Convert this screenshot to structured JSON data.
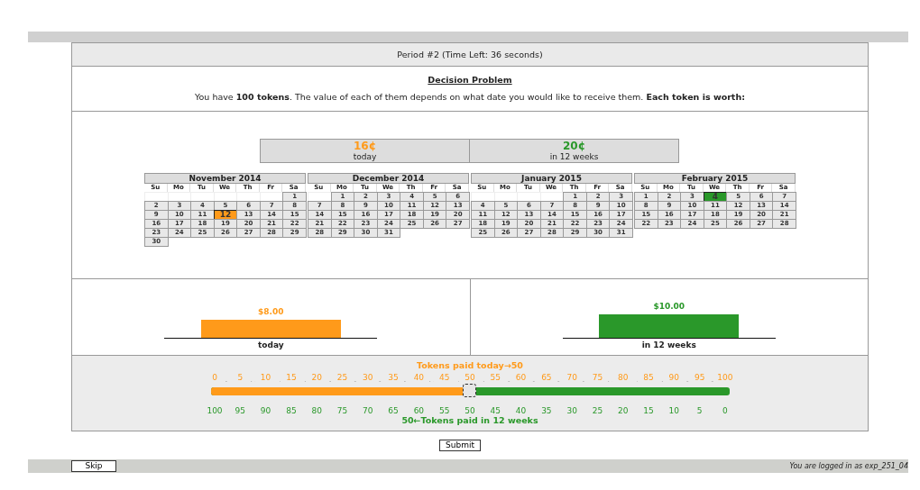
{
  "header": {
    "title": "Period #2 (Time Left: 36 seconds)"
  },
  "decision": {
    "heading": "Decision Problem",
    "text": "You have **100 tokens**. The value of each of them depends on what date you would like to receive them. **Each token is worth:**"
  },
  "values": [
    {
      "amount": "16¢",
      "when": "today",
      "color": "#ff9a1a"
    },
    {
      "amount": "20¢",
      "when": "in 12 weeks",
      "color": "#2a982a"
    }
  ],
  "calendars": [
    {
      "month": "November 2014",
      "weekdays": [
        "Su",
        "Mo",
        "Tu",
        "We",
        "Th",
        "Fr",
        "Sa"
      ],
      "weeks": [
        [
          {
            "kind": "blank"
          },
          {
            "kind": "blank"
          },
          {
            "kind": "blank"
          },
          {
            "kind": "blank"
          },
          {
            "kind": "blank"
          },
          {
            "kind": "blank"
          },
          {
            "kind": "day",
            "day": "1",
            "selected": false
          }
        ],
        [
          {
            "kind": "day",
            "day": "2",
            "selected": false
          },
          {
            "kind": "day",
            "day": "3",
            "selected": false
          },
          {
            "kind": "day",
            "day": "4",
            "selected": false
          },
          {
            "kind": "day",
            "day": "5",
            "selected": false
          },
          {
            "kind": "day",
            "day": "6",
            "selected": false
          },
          {
            "kind": "day",
            "day": "7",
            "selected": false
          },
          {
            "kind": "day",
            "day": "8",
            "selected": false
          }
        ],
        [
          {
            "kind": "day",
            "day": "9",
            "selected": false
          },
          {
            "kind": "day",
            "day": "10",
            "selected": false
          },
          {
            "kind": "day",
            "day": "11",
            "selected": false
          },
          {
            "kind": "day",
            "day": "12",
            "selected": true,
            "color": "#ff9a1a"
          },
          {
            "kind": "day",
            "day": "13",
            "selected": false
          },
          {
            "kind": "day",
            "day": "14",
            "selected": false
          },
          {
            "kind": "day",
            "day": "15",
            "selected": false
          }
        ],
        [
          {
            "kind": "day",
            "day": "16",
            "selected": false
          },
          {
            "kind": "day",
            "day": "17",
            "selected": false
          },
          {
            "kind": "day",
            "day": "18",
            "selected": false
          },
          {
            "kind": "day",
            "day": "19",
            "selected": false
          },
          {
            "kind": "day",
            "day": "20",
            "selected": false
          },
          {
            "kind": "day",
            "day": "21",
            "selected": false
          },
          {
            "kind": "day",
            "day": "22",
            "selected": false
          }
        ],
        [
          {
            "kind": "day",
            "day": "23",
            "selected": false
          },
          {
            "kind": "day",
            "day": "24",
            "selected": false
          },
          {
            "kind": "day",
            "day": "25",
            "selected": false
          },
          {
            "kind": "day",
            "day": "26",
            "selected": false
          },
          {
            "kind": "day",
            "day": "27",
            "selected": false
          },
          {
            "kind": "day",
            "day": "28",
            "selected": false
          },
          {
            "kind": "day",
            "day": "29",
            "selected": false
          }
        ],
        [
          {
            "kind": "day",
            "day": "30",
            "selected": false
          }
        ]
      ]
    },
    {
      "month": "December 2014",
      "weekdays": [
        "Su",
        "Mo",
        "Tu",
        "We",
        "Th",
        "Fr",
        "Sa"
      ],
      "weeks": [
        [
          {
            "kind": "blank"
          },
          {
            "kind": "day",
            "day": "1",
            "selected": false
          },
          {
            "kind": "day",
            "day": "2",
            "selected": false
          },
          {
            "kind": "day",
            "day": "3",
            "selected": false
          },
          {
            "kind": "day",
            "day": "4",
            "selected": false
          },
          {
            "kind": "day",
            "day": "5",
            "selected": false
          },
          {
            "kind": "day",
            "day": "6",
            "selected": false
          }
        ],
        [
          {
            "kind": "day",
            "day": "7",
            "selected": false
          },
          {
            "kind": "day",
            "day": "8",
            "selected": false
          },
          {
            "kind": "day",
            "day": "9",
            "selected": false
          },
          {
            "kind": "day",
            "day": "10",
            "selected": false
          },
          {
            "kind": "day",
            "day": "11",
            "selected": false
          },
          {
            "kind": "day",
            "day": "12",
            "selected": false
          },
          {
            "kind": "day",
            "day": "13",
            "selected": false
          }
        ],
        [
          {
            "kind": "day",
            "day": "14",
            "selected": false
          },
          {
            "kind": "day",
            "day": "15",
            "selected": false
          },
          {
            "kind": "day",
            "day": "16",
            "selected": false
          },
          {
            "kind": "day",
            "day": "17",
            "selected": false
          },
          {
            "kind": "day",
            "day": "18",
            "selected": false
          },
          {
            "kind": "day",
            "day": "19",
            "selected": false
          },
          {
            "kind": "day",
            "day": "20",
            "selected": false
          }
        ],
        [
          {
            "kind": "day",
            "day": "21",
            "selected": false
          },
          {
            "kind": "day",
            "day": "22",
            "selected": false
          },
          {
            "kind": "day",
            "day": "23",
            "selected": false
          },
          {
            "kind": "day",
            "day": "24",
            "selected": false
          },
          {
            "kind": "day",
            "day": "25",
            "selected": false
          },
          {
            "kind": "day",
            "day": "26",
            "selected": false
          },
          {
            "kind": "day",
            "day": "27",
            "selected": false
          }
        ],
        [
          {
            "kind": "day",
            "day": "28",
            "selected": false
          },
          {
            "kind": "day",
            "day": "29",
            "selected": false
          },
          {
            "kind": "day",
            "day": "30",
            "selected": false
          },
          {
            "kind": "day",
            "day": "31",
            "selected": false
          }
        ]
      ]
    },
    {
      "month": "January 2015",
      "weekdays": [
        "Su",
        "Mo",
        "Tu",
        "We",
        "Th",
        "Fr",
        "Sa"
      ],
      "weeks": [
        [
          {
            "kind": "blank"
          },
          {
            "kind": "blank"
          },
          {
            "kind": "blank"
          },
          {
            "kind": "blank"
          },
          {
            "kind": "day",
            "day": "1",
            "selected": false
          },
          {
            "kind": "day",
            "day": "2",
            "selected": false
          },
          {
            "kind": "day",
            "day": "3",
            "selected": false
          }
        ],
        [
          {
            "kind": "day",
            "day": "4",
            "selected": false
          },
          {
            "kind": "day",
            "day": "5",
            "selected": false
          },
          {
            "kind": "day",
            "day": "6",
            "selected": false
          },
          {
            "kind": "day",
            "day": "7",
            "selected": false
          },
          {
            "kind": "day",
            "day": "8",
            "selected": false
          },
          {
            "kind": "day",
            "day": "9",
            "selected": false
          },
          {
            "kind": "day",
            "day": "10",
            "selected": false
          }
        ],
        [
          {
            "kind": "day",
            "day": "11",
            "selected": false
          },
          {
            "kind": "day",
            "day": "12",
            "selected": false
          },
          {
            "kind": "day",
            "day": "13",
            "selected": false
          },
          {
            "kind": "day",
            "day": "14",
            "selected": false
          },
          {
            "kind": "day",
            "day": "15",
            "selected": false
          },
          {
            "kind": "day",
            "day": "16",
            "selected": false
          },
          {
            "kind": "day",
            "day": "17",
            "selected": false
          }
        ],
        [
          {
            "kind": "day",
            "day": "18",
            "selected": false
          },
          {
            "kind": "day",
            "day": "19",
            "selected": false
          },
          {
            "kind": "day",
            "day": "20",
            "selected": false
          },
          {
            "kind": "day",
            "day": "21",
            "selected": false
          },
          {
            "kind": "day",
            "day": "22",
            "selected": false
          },
          {
            "kind": "day",
            "day": "23",
            "selected": false
          },
          {
            "kind": "day",
            "day": "24",
            "selected": false
          }
        ],
        [
          {
            "kind": "day",
            "day": "25",
            "selected": false
          },
          {
            "kind": "day",
            "day": "26",
            "selected": false
          },
          {
            "kind": "day",
            "day": "27",
            "selected": false
          },
          {
            "kind": "day",
            "day": "28",
            "selected": false
          },
          {
            "kind": "day",
            "day": "29",
            "selected": false
          },
          {
            "kind": "day",
            "day": "30",
            "selected": false
          },
          {
            "kind": "day",
            "day": "31",
            "selected": false
          }
        ]
      ]
    },
    {
      "month": "February 2015",
      "weekdays": [
        "Su",
        "Mo",
        "Tu",
        "We",
        "Th",
        "Fr",
        "Sa"
      ],
      "weeks": [
        [
          {
            "kind": "day",
            "day": "1",
            "selected": false
          },
          {
            "kind": "day",
            "day": "2",
            "selected": false
          },
          {
            "kind": "day",
            "day": "3",
            "selected": false
          },
          {
            "kind": "day",
            "day": "4",
            "selected": true,
            "color": "#2a982a"
          },
          {
            "kind": "day",
            "day": "5",
            "selected": false
          },
          {
            "kind": "day",
            "day": "6",
            "selected": false
          },
          {
            "kind": "day",
            "day": "7",
            "selected": false
          }
        ],
        [
          {
            "kind": "day",
            "day": "8",
            "selected": false
          },
          {
            "kind": "day",
            "day": "9",
            "selected": false
          },
          {
            "kind": "day",
            "day": "10",
            "selected": false
          },
          {
            "kind": "day",
            "day": "11",
            "selected": false
          },
          {
            "kind": "day",
            "day": "12",
            "selected": false
          },
          {
            "kind": "day",
            "day": "13",
            "selected": false
          },
          {
            "kind": "day",
            "day": "14",
            "selected": false
          }
        ],
        [
          {
            "kind": "day",
            "day": "15",
            "selected": false
          },
          {
            "kind": "day",
            "day": "16",
            "selected": false
          },
          {
            "kind": "day",
            "day": "17",
            "selected": false
          },
          {
            "kind": "day",
            "day": "18",
            "selected": false
          },
          {
            "kind": "day",
            "day": "19",
            "selected": false
          },
          {
            "kind": "day",
            "day": "20",
            "selected": false
          },
          {
            "kind": "day",
            "day": "21",
            "selected": false
          }
        ],
        [
          {
            "kind": "day",
            "day": "22",
            "selected": false
          },
          {
            "kind": "day",
            "day": "23",
            "selected": false
          },
          {
            "kind": "day",
            "day": "24",
            "selected": false
          },
          {
            "kind": "day",
            "day": "25",
            "selected": false
          },
          {
            "kind": "day",
            "day": "26",
            "selected": false
          },
          {
            "kind": "day",
            "day": "27",
            "selected": false
          },
          {
            "kind": "day",
            "day": "28",
            "selected": false
          }
        ]
      ]
    }
  ],
  "payouts": [
    {
      "amount": "$8.00",
      "label": "today",
      "color": "#ff9a1a"
    },
    {
      "amount": "$10.00",
      "label": "in 12 weeks",
      "color": "#2a982a"
    }
  ],
  "slider": {
    "top_label": "Tokens paid today→50",
    "top_ticks": [
      "0",
      "5",
      "10",
      "15",
      "20",
      "25",
      "30",
      "35",
      "40",
      "45",
      "50",
      "55",
      "60",
      "65",
      "70",
      "75",
      "80",
      "85",
      "90",
      "95",
      "100"
    ],
    "level": 0.5,
    "bottom_ticks": [
      "100",
      "95",
      "90",
      "85",
      "80",
      "75",
      "70",
      "65",
      "60",
      "55",
      "50",
      "45",
      "40",
      "35",
      "30",
      "25",
      "20",
      "15",
      "10",
      "5",
      "0"
    ],
    "bottom_label": "50←Tokens paid in 12 weeks"
  },
  "submit": "Submit",
  "footer": {
    "skip": "Skip",
    "login": "You are logged in as exp_251_04"
  }
}
